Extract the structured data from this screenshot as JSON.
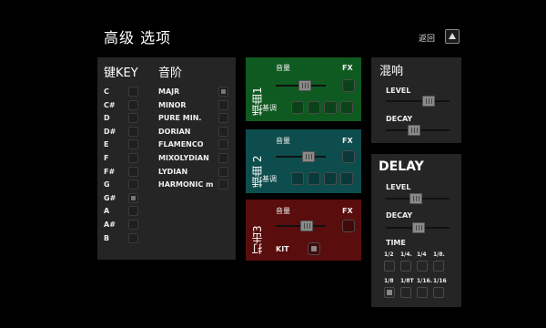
{
  "header": {
    "title": "高级 选项",
    "back_label": "返回"
  },
  "key_panel": {
    "key_header": "键KEY",
    "scale_header": "音阶",
    "keys": [
      {
        "label": "C",
        "checked": false
      },
      {
        "label": "C#",
        "checked": false
      },
      {
        "label": "D",
        "checked": false
      },
      {
        "label": "D#",
        "checked": false
      },
      {
        "label": "E",
        "checked": false
      },
      {
        "label": "F",
        "checked": false
      },
      {
        "label": "F#",
        "checked": false
      },
      {
        "label": "G",
        "checked": false
      },
      {
        "label": "G#",
        "checked": true
      },
      {
        "label": "A",
        "checked": false
      },
      {
        "label": "A#",
        "checked": false
      },
      {
        "label": "B",
        "checked": false
      }
    ],
    "scales": [
      {
        "label": "MAJR",
        "checked": true
      },
      {
        "label": "MINOR",
        "checked": false
      },
      {
        "label": "PURE MIN.",
        "checked": false
      },
      {
        "label": "DORIAN",
        "checked": false
      },
      {
        "label": "FLAMENCO",
        "checked": false
      },
      {
        "label": "MIXOLYDIAN",
        "checked": false
      },
      {
        "label": "LYDIAN",
        "checked": false
      },
      {
        "label": "HARMONIC m",
        "checked": false
      }
    ]
  },
  "tracks": [
    {
      "name": "插曲1",
      "color": "#0f5a20",
      "volume_label": "音量",
      "volume": 0.6,
      "fx_label": "FX",
      "fx_on": false,
      "key_label": "基调",
      "keys": [
        false,
        false,
        false,
        false
      ]
    },
    {
      "name": "插曲 2",
      "color": "#0d4d4d",
      "volume_label": "音量",
      "volume": 0.7,
      "fx_label": "FX",
      "fx_on": false,
      "key_label": "基调",
      "keys": [
        false,
        false,
        false,
        false
      ]
    },
    {
      "name": "打击3",
      "color": "#5a0d0d",
      "volume_label": "音量",
      "volume": 0.65,
      "fx_label": "FX",
      "fx_on": false,
      "kit_label": "KIT",
      "kit_on": true
    }
  ],
  "mix": {
    "title": "混响",
    "level_label": "LEVEL",
    "level": 0.72,
    "decay_label": "DECAY",
    "decay": 0.42
  },
  "delay": {
    "title": "DELAY",
    "level_label": "LEVEL",
    "level": 0.47,
    "decay_label": "DECAY",
    "decay": 0.52,
    "time_label": "TIME",
    "time_row1": [
      "1/2",
      "1/4.",
      "1/4",
      "1/8."
    ],
    "time_row2": [
      "1/8",
      "1/8T",
      "1/16.",
      "1/16"
    ],
    "time_selected": "1/8"
  },
  "colors": {
    "panel": "#252525",
    "green": "#0f5a20",
    "teal": "#0d4d4d",
    "red": "#5a0d0d"
  }
}
